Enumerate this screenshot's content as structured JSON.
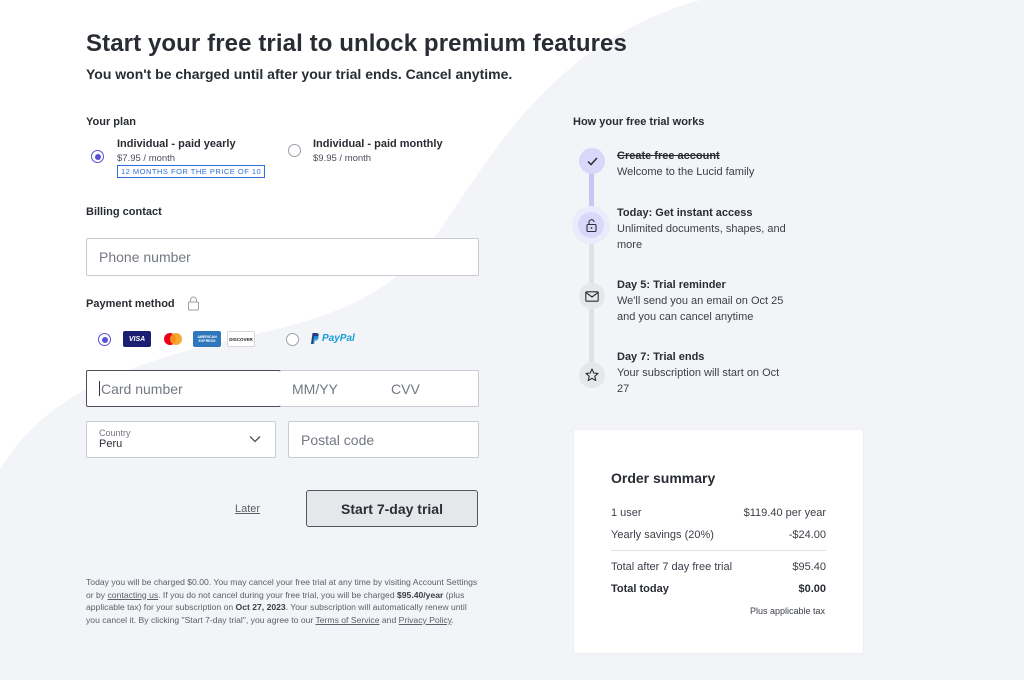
{
  "header": {
    "title": "Start your free trial to unlock premium features",
    "subtitle": "You won't be charged until after your trial ends. Cancel anytime."
  },
  "plan": {
    "label": "Your plan",
    "options": [
      {
        "name": "Individual - paid yearly",
        "price": "$7.95 / month",
        "badge": "12 MONTHS FOR THE PRICE OF 10",
        "selected": true
      },
      {
        "name": "Individual - paid monthly",
        "price": "$9.95 / month",
        "selected": false
      }
    ]
  },
  "billing": {
    "label": "Billing contact",
    "phone_placeholder": "Phone number"
  },
  "payment": {
    "label": "Payment method",
    "card_brands": [
      "VISA",
      "Mastercard",
      "AMERICAN EXPRESS",
      "DISCOVER"
    ],
    "paypal_label": "PayPal",
    "card_placeholder": "Card number",
    "expiry_placeholder": "MM/YY",
    "cvv_placeholder": "CVV",
    "country_label": "Country",
    "country_value": "Peru",
    "postal_placeholder": "Postal code"
  },
  "actions": {
    "later": "Later",
    "start": "Start 7-day trial"
  },
  "legal": {
    "p1": "Today you will be charged $0.00. You may cancel your free trial at any time by visiting Account Settings or by ",
    "contact_link": "contacting us",
    "p2": ". If you do not cancel during your free trial, you will be charged ",
    "amount": "$95.40/year",
    "p3": " (plus applicable tax) for your subscription on ",
    "date": "Oct 27, 2023",
    "p4": ". Your subscription will automatically renew until you cancel it. By clicking \"Start 7-day trial\", you agree to our ",
    "tos_link": "Terms of Service",
    "p5": " and ",
    "privacy_link": "Privacy Policy",
    "p6": "."
  },
  "timeline": {
    "label": "How your free trial works",
    "steps": [
      {
        "title": "Create free account",
        "desc": "Welcome to the Lucid family",
        "icon": "check-icon"
      },
      {
        "title": "Today: Get instant access",
        "desc": "Unlimited documents, shapes, and more",
        "icon": "unlock-icon"
      },
      {
        "title": "Day 5: Trial reminder",
        "desc": "We'll send you an email on Oct 25 and you can cancel anytime",
        "icon": "mail-icon"
      },
      {
        "title": "Day 7: Trial ends",
        "desc": "Your subscription will start on Oct 27",
        "icon": "star-icon"
      }
    ]
  },
  "summary": {
    "title": "Order summary",
    "rows": [
      {
        "label": "1 user",
        "value": "$119.40 per year"
      },
      {
        "label": "Yearly savings (20%)",
        "value": "-$24.00"
      },
      {
        "label": "Total after 7 day free trial",
        "value": "$95.40"
      },
      {
        "label": "Total today",
        "value": "$0.00"
      }
    ],
    "note": "Plus applicable tax"
  },
  "colors": {
    "accent": "#5551d6",
    "badge": "#2f6fd6",
    "background_shape": "#f3f4f7"
  }
}
